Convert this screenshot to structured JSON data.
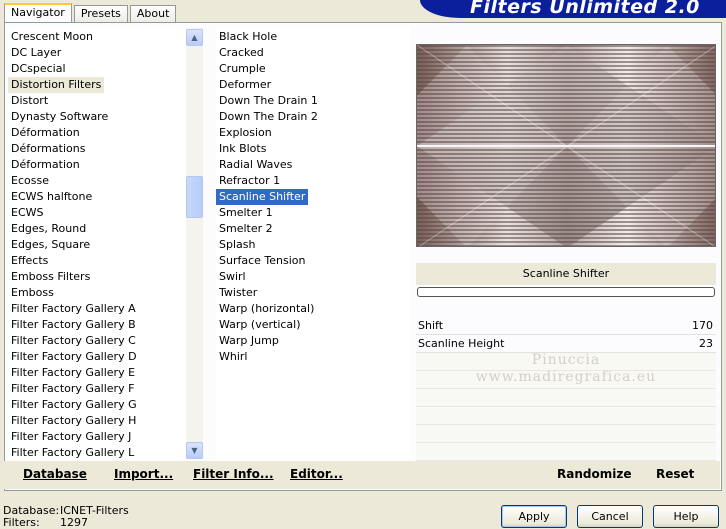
{
  "tabs": [
    "Navigator",
    "Presets",
    "About"
  ],
  "banner_title": "Filters Unlimited 2.0",
  "categories": [
    "Crescent Moon",
    "DC Layer",
    "DCspecial",
    "Distortion Filters",
    "Distort",
    "Dynasty Software",
    "Déformation",
    "Déformations",
    "Déformation",
    "Ecosse",
    "ECWS halftone",
    "ECWS",
    "Edges, Round",
    "Edges, Square",
    "Effects",
    "Emboss Filters",
    "Emboss",
    "Filter Factory Gallery A",
    "Filter Factory Gallery B",
    "Filter Factory Gallery C",
    "Filter Factory Gallery D",
    "Filter Factory Gallery E",
    "Filter Factory Gallery F",
    "Filter Factory Gallery G",
    "Filter Factory Gallery H",
    "Filter Factory Gallery J",
    "Filter Factory Gallery L"
  ],
  "selected_category": "Distortion Filters",
  "filters": [
    "Black Hole",
    "Cracked",
    "Crumple",
    "Deformer",
    "Down The Drain 1",
    "Down The Drain 2",
    "Explosion",
    "Ink Blots",
    "Radial Waves",
    "Refractor 1",
    "Scanline Shifter",
    "Smelter 1",
    "Smelter 2",
    "Splash",
    "Surface Tension",
    "Swirl",
    "Twister",
    "Warp (horizontal)",
    "Warp (vertical)",
    "Warp Jump",
    "Whirl"
  ],
  "selected_filter": "Scanline Shifter",
  "preview_filter_name": "Scanline Shifter",
  "params": [
    {
      "label": "Shift",
      "value": "170"
    },
    {
      "label": "Scanline Height",
      "value": "23"
    }
  ],
  "watermark": {
    "line1": "Pinuccia",
    "line2": "www.madiregrafica.eu"
  },
  "bottom_links": {
    "database": "Database",
    "import": "Import...",
    "filter_info": "Filter Info...",
    "editor": "Editor...",
    "randomize": "Randomize",
    "reset": "Reset"
  },
  "status": {
    "database_label": "Database:",
    "database_value": "ICNET-Filters",
    "filters_label": "Filters:",
    "filters_value": "1297"
  },
  "buttons": {
    "apply": "Apply",
    "cancel": "Cancel",
    "help": "Help"
  },
  "colors": {
    "selection": "#316ac5",
    "banner": "#0b1e9c",
    "dialog_bg": "#ece9d8"
  }
}
